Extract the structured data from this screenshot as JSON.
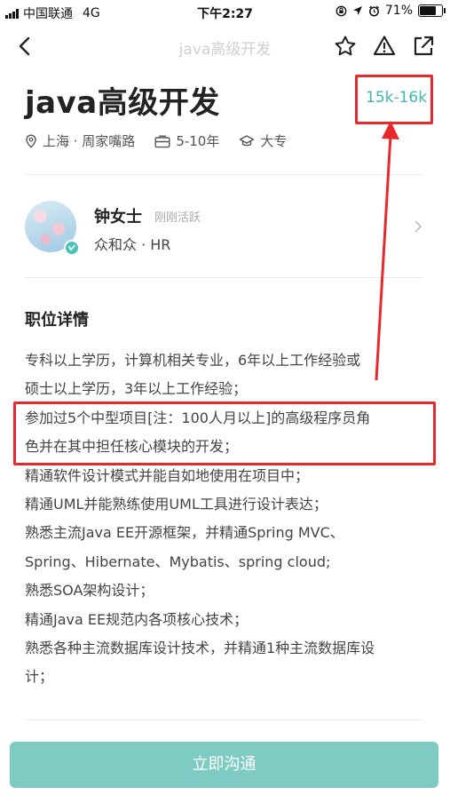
{
  "status_bar": {
    "carrier": "中国联通",
    "network": "4G",
    "time": "下午2:27",
    "battery": "71%"
  },
  "nav": {
    "title": "java高级开发",
    "icons": [
      "back-arrow-icon",
      "star-icon",
      "warning-icon",
      "share-icon"
    ]
  },
  "job": {
    "title": "java高级开发",
    "salary": "15k-16k",
    "location": "上海 · 周家嘴路",
    "experience": "5-10年",
    "education": "大专"
  },
  "hr": {
    "name": "钟女士",
    "active_status": "刚刚活跃",
    "company": "众和众 · HR"
  },
  "details": {
    "title": "职位详情",
    "lines": [
      "专科以上学历，计算机相关专业，6年以上工作经验或",
      "硕士以上学历，3年以上工作经验；",
      "参加过5个中型项目[注：100人月以上]的高级程序员角",
      "色并在其中担任核心模块的开发；",
      "精通软件设计模式并能自如地使用在项目中；",
      "精通UML并能熟练使用UML工具进行设计表达；",
      "熟悉主流Java EE开源框架，并精通Spring MVC、",
      "Spring、Hibernate、Mybatis、spring cloud;",
      "熟悉SOA架构设计；",
      "精通Java EE规范内各项核心技术；",
      "熟悉各种主流数据库设计技术，并精通1种主流数据库设",
      "计；"
    ]
  },
  "cta": {
    "label": "立即沟通"
  },
  "colors": {
    "accent": "#3fb8ad",
    "button": "#7ecbc4",
    "annotation": "#e8282a"
  }
}
